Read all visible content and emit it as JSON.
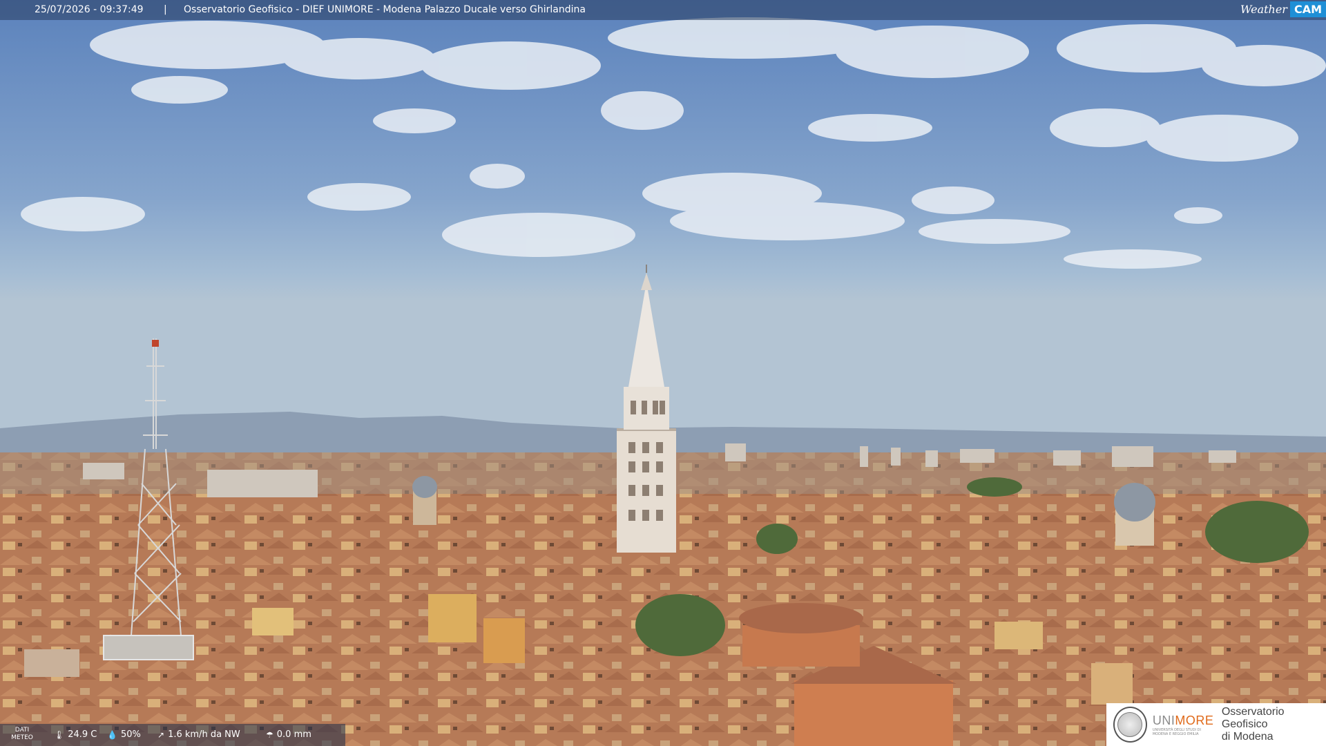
{
  "header": {
    "timestamp": "25/07/2026 - 09:37:49",
    "separator": "|",
    "title": "Osservatorio Geofisico - DIEF UNIMORE - Modena Palazzo Ducale verso Ghirlandina"
  },
  "logo": {
    "weather": "Weather",
    "cam": "CAM"
  },
  "meteo": {
    "label_line1": "DATI",
    "label_line2": "METEO",
    "temperature": "24.9 C",
    "humidity": "50%",
    "wind": "1.6 km/h da NW",
    "rain": "0.0 mm",
    "icons": [
      "thermometer-icon",
      "humidity-drop-icon",
      "wind-icon",
      "rain-gauge-icon"
    ]
  },
  "institution": {
    "brand_gray": "UNI",
    "brand_orange": "MORE",
    "brand_sub": "UNIVERSITÀ DEGLI STUDI DI MODENA E REGGIO EMILIA",
    "observatory_line1": "Osservatorio Geofisico",
    "observatory_line2": "di Modena"
  },
  "colors": {
    "sky_top": "#5f86bf",
    "sky_horizon": "#a9c0d6",
    "roof_terracotta": "#b87a55",
    "tower_stone": "#e7e0d6",
    "unimore_orange": "#e06a1a"
  }
}
